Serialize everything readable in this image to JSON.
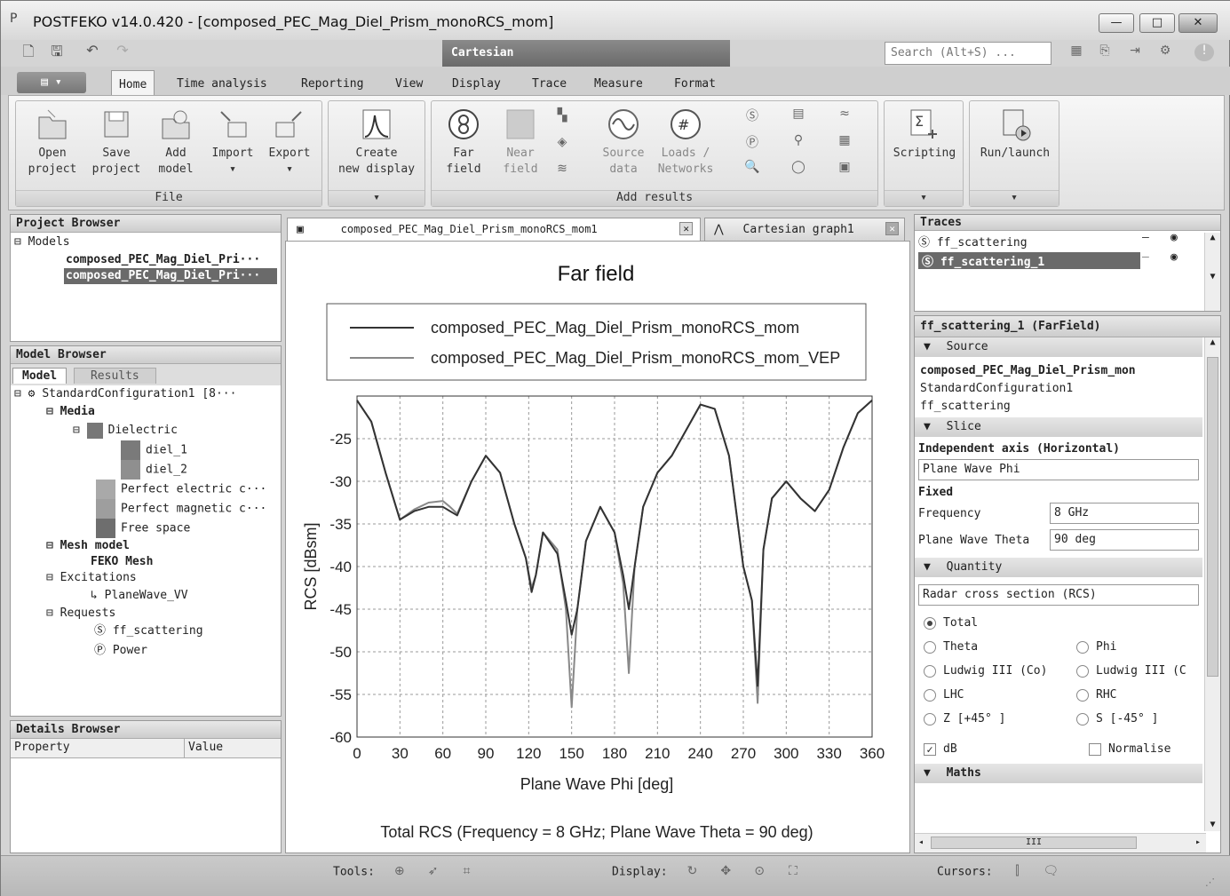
{
  "window": {
    "title": "POSTFEKO v14.0.420 - [composed_PEC_Mag_Diel_Prism_monoRCS_mom]",
    "minimize": "—",
    "maximize": "□",
    "close": "✕"
  },
  "quick_access": [
    "new-icon",
    "save-icon",
    "undo-icon",
    "redo-icon"
  ],
  "context_tab": "Cartesian",
  "search": {
    "placeholder": "Search (Alt+S) ..."
  },
  "tabs": [
    "Home",
    "Time analysis",
    "Reporting",
    "View",
    "Display",
    "Trace",
    "Measure",
    "Format"
  ],
  "ribbon": {
    "file": {
      "label": "File",
      "open": [
        "Open",
        "project"
      ],
      "save": [
        "Save",
        "project"
      ],
      "add": [
        "Add",
        "model"
      ],
      "import": "Import",
      "export": "Export"
    },
    "display": {
      "create": [
        "Create",
        "new display"
      ]
    },
    "results": {
      "label": "Add results",
      "far": [
        "Far",
        "field"
      ],
      "near": [
        "Near",
        "field"
      ],
      "source": [
        "Source",
        "data"
      ],
      "loads": [
        "Loads /",
        "Networks"
      ]
    },
    "scripting": "Scripting",
    "run": "Run/launch"
  },
  "project_browser": {
    "title": "Project Browser",
    "root": "Models",
    "items": [
      "composed_PEC_Mag_Diel_Pri···",
      "composed_PEC_Mag_Diel_Pri···"
    ]
  },
  "model_browser": {
    "title": "Model Browser",
    "tabs": [
      "Model",
      "Results"
    ],
    "root": "StandardConfiguration1 [8···",
    "media": "Media",
    "dielectric": "Dielectric",
    "diel1": "diel_1",
    "diel2": "diel_2",
    "pec": "Perfect electric c···",
    "pmc": "Perfect magnetic c···",
    "free": "Free space",
    "mesh": "Mesh model",
    "feko_mesh": "FEKO Mesh",
    "excitations": "Excitations",
    "planewave": "PlaneWave_VV",
    "requests": "Requests",
    "ff": "ff_scattering",
    "power": "Power"
  },
  "details_browser": {
    "title": "Details Browser",
    "col1": "Property",
    "col2": "Value"
  },
  "doc_tabs": [
    "composed_PEC_Mag_Diel_Prism_monoRCS_mom1",
    "Cartesian graph1"
  ],
  "chart_data": {
    "type": "line",
    "title": "Far field",
    "xlabel": "Plane Wave Phi [deg]",
    "ylabel": "RCS [dBsm]",
    "caption": "Total RCS (Frequency = 8 GHz; Plane Wave Theta = 90 deg)",
    "xlim": [
      0,
      360
    ],
    "ylim": [
      -60,
      -20
    ],
    "xticks": [
      0,
      30,
      60,
      90,
      120,
      150,
      180,
      210,
      240,
      270,
      300,
      330,
      360
    ],
    "yticks": [
      -25,
      -30,
      -35,
      -40,
      -45,
      -50,
      -55,
      -60
    ],
    "grid": true,
    "legend_position": "top",
    "series": [
      {
        "name": "composed_PEC_Mag_Diel_Prism_monoRCS_mom",
        "color": "#333333",
        "x": [
          0,
          10,
          20,
          30,
          40,
          50,
          60,
          65,
          70,
          80,
          90,
          100,
          110,
          118,
          122,
          125,
          130,
          140,
          146,
          150,
          154,
          160,
          170,
          180,
          186,
          190,
          194,
          200,
          210,
          220,
          230,
          240,
          250,
          260,
          270,
          276,
          280,
          284,
          290,
          300,
          310,
          320,
          330,
          340,
          350,
          360
        ],
        "y": [
          -20.5,
          -23,
          -29,
          -34.5,
          -33.5,
          -33,
          -33,
          -33.5,
          -34,
          -30,
          -27,
          -29,
          -35,
          -39,
          -43,
          -41,
          -36,
          -38.5,
          -44,
          -48,
          -45,
          -37,
          -33,
          -36,
          -41,
          -45,
          -40,
          -33,
          -29,
          -27,
          -24,
          -21,
          -21.5,
          -27,
          -40,
          -44,
          -54,
          -38,
          -32,
          -30,
          -32,
          -33.5,
          -31,
          -26,
          -22,
          -20.5
        ]
      },
      {
        "name": "composed_PEC_Mag_Diel_Prism_monoRCS_mom_VEP",
        "color": "#888888",
        "x": [
          0,
          10,
          20,
          30,
          40,
          50,
          60,
          65,
          70,
          80,
          90,
          100,
          110,
          118,
          122,
          125,
          130,
          140,
          146,
          150,
          154,
          160,
          170,
          180,
          186,
          190,
          194,
          200,
          210,
          220,
          230,
          240,
          250,
          260,
          270,
          276,
          280,
          284,
          290,
          300,
          310,
          320,
          330,
          340,
          350,
          360
        ],
        "y": [
          -20.5,
          -23,
          -29,
          -34.5,
          -33.3,
          -32.5,
          -32.3,
          -33,
          -33.8,
          -30,
          -27,
          -29,
          -35,
          -39,
          -42.5,
          -41,
          -36,
          -38,
          -45,
          -56.5,
          -45,
          -37,
          -33,
          -36,
          -42,
          -52.5,
          -40,
          -33,
          -29,
          -27,
          -24,
          -21,
          -21.5,
          -27,
          -40,
          -44,
          -56,
          -38,
          -32,
          -30,
          -32,
          -33.5,
          -31,
          -26,
          -22,
          -20.5
        ]
      }
    ]
  },
  "traces": {
    "title": "Traces",
    "items": [
      "ff_scattering",
      "ff_scattering_1"
    ]
  },
  "properties": {
    "title": "ff_scattering_1 (FarField)",
    "source_label": "Source",
    "source_lines": [
      "composed_PEC_Mag_Diel_Prism_mon",
      "StandardConfiguration1",
      "ff_scattering"
    ],
    "slice_label": "Slice",
    "indep_axis": "Independent axis (Horizontal)",
    "indep_value": "Plane Wave Phi",
    "fixed": "Fixed",
    "freq_label": "Frequency",
    "freq_value": "8 GHz",
    "theta_label": "Plane Wave Theta",
    "theta_value": "90 deg",
    "quantity_label": "Quantity",
    "quantity_value": "Radar cross section (RCS)",
    "total": "Total",
    "theta": "Theta",
    "phi": "Phi",
    "ludwig_co": "Ludwig III (Co)",
    "ludwig_c": "Ludwig III (C",
    "lhc": "LHC",
    "rhc": "RHC",
    "z45": "Z [+45° ]",
    "s45": "S [-45° ]",
    "db": "dB",
    "normalise": "Normalise",
    "maths": "Maths",
    "scroll_mark": "III"
  },
  "status": {
    "tools": "Tools:",
    "display": "Display:",
    "cursors": "Cursors:"
  }
}
